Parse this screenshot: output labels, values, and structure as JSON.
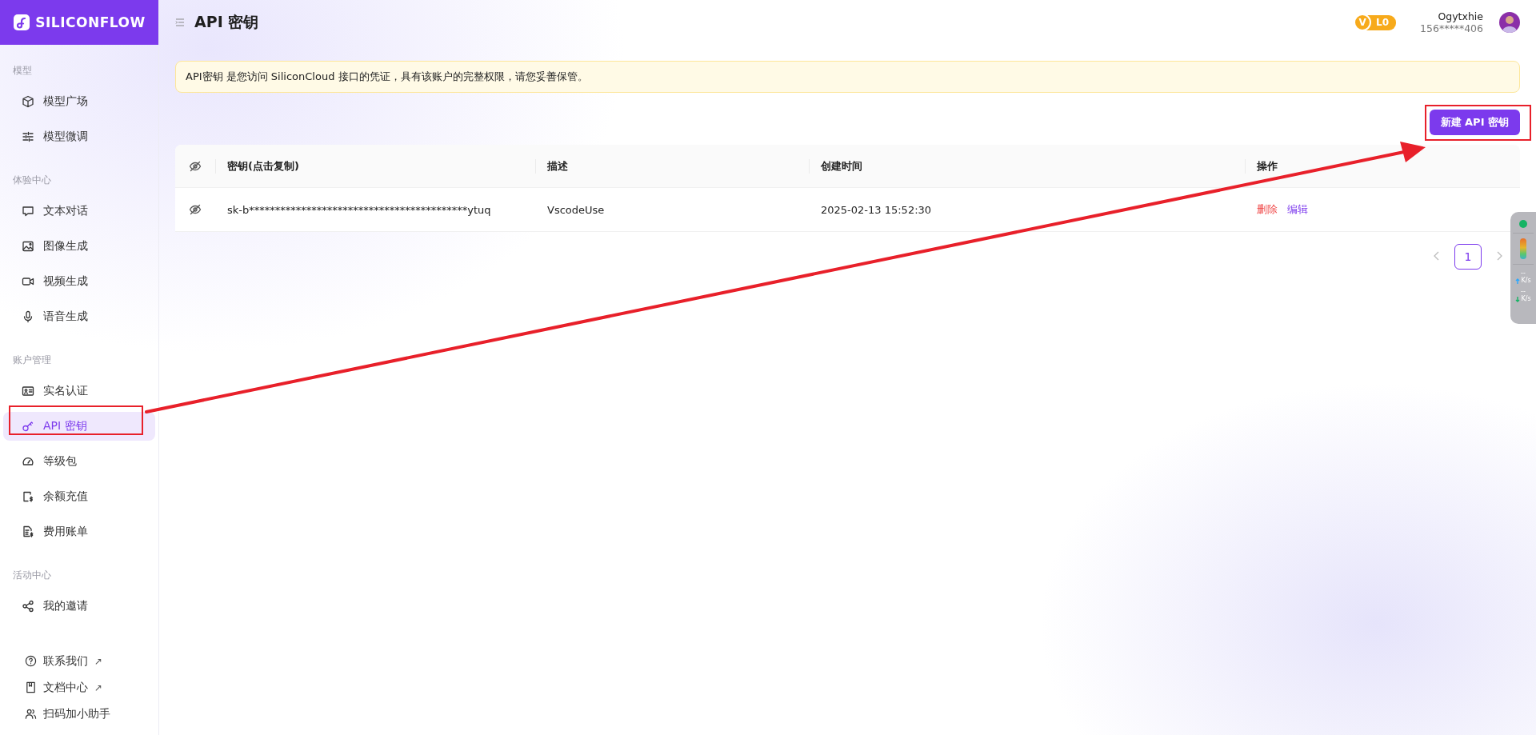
{
  "brand": {
    "name": "SILICONFLOW"
  },
  "header": {
    "title": "API 密钥",
    "level_badge": {
      "letter": "V",
      "level": "L0"
    },
    "user": {
      "name": "Ogytxhie",
      "phone": "156*****406"
    }
  },
  "sidebar": {
    "sections": [
      {
        "label": "模型",
        "items": [
          {
            "label": "模型广场",
            "selected": false
          },
          {
            "label": "模型微调",
            "selected": false
          }
        ]
      },
      {
        "label": "体验中心",
        "items": [
          {
            "label": "文本对话",
            "selected": false
          },
          {
            "label": "图像生成",
            "selected": false
          },
          {
            "label": "视频生成",
            "selected": false
          },
          {
            "label": "语音生成",
            "selected": false
          }
        ]
      },
      {
        "label": "账户管理",
        "items": [
          {
            "label": "实名认证",
            "selected": false
          },
          {
            "label": "API 密钥",
            "selected": true
          },
          {
            "label": "等级包",
            "selected": false
          },
          {
            "label": "余额充值",
            "selected": false
          },
          {
            "label": "费用账单",
            "selected": false
          }
        ]
      },
      {
        "label": "活动中心",
        "items": [
          {
            "label": "我的邀请",
            "selected": false
          }
        ]
      }
    ],
    "footer_links": [
      {
        "label": "联系我们",
        "external": "↗"
      },
      {
        "label": "文档中心",
        "external": "↗"
      },
      {
        "label": "扫码加小助手"
      }
    ]
  },
  "notice": {
    "text": "API密钥 是您访问 SiliconCloud 接口的凭证，具有该账户的完整权限，请您妥善保管。"
  },
  "new_key_button": "新建 API 密钥",
  "table": {
    "columns": [
      "密钥(点击复制)",
      "描述",
      "创建时间",
      "操作"
    ],
    "rows": [
      {
        "key": "sk-b******************************************ytuq",
        "description": "VscodeUse",
        "created": "2025-02-13 15:52:30",
        "actions": [
          {
            "label": "删除",
            "kind": "danger"
          },
          {
            "label": "编辑",
            "kind": "primary"
          }
        ]
      }
    ]
  },
  "pagination": {
    "pages": [
      {
        "label": "1",
        "selected": true
      }
    ]
  },
  "net_widget": {
    "upload": {
      "value": "--",
      "unit": "K/s"
    },
    "download": {
      "value": "--",
      "unit": "K/s"
    }
  },
  "annotations": [
    {
      "kind": "frame"
    },
    {
      "kind": "frame"
    },
    {
      "kind": "arrow"
    }
  ]
}
